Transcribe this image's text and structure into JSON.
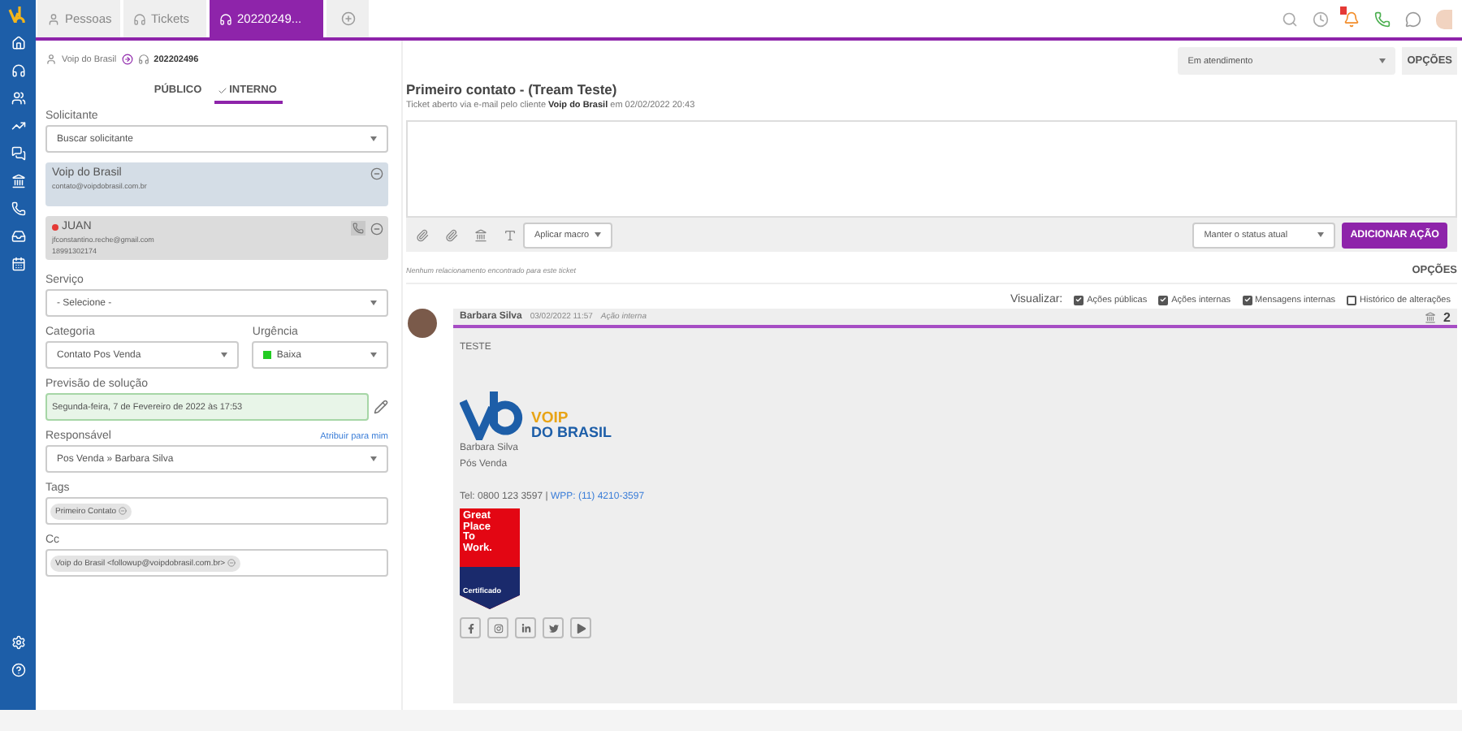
{
  "top_tabs": [
    {
      "label": "Pessoas",
      "selected": false
    },
    {
      "label": "Tickets",
      "selected": false
    },
    {
      "label": "20220249...",
      "selected": true
    }
  ],
  "breadcrumb": {
    "client": "Voip do Brasil",
    "ticket": "202202496"
  },
  "visibility_tabs": [
    {
      "label": "PÚBLICO",
      "selected": false
    },
    {
      "label": "INTERNO",
      "selected": true
    }
  ],
  "requester": {
    "label": "Solicitante",
    "placeholder": "Buscar solicitante"
  },
  "contacts": [
    {
      "kind": "company",
      "name": "Voip do Brasil",
      "lines": [
        "contato@voipdobrasil.com.br"
      ],
      "phone": false
    },
    {
      "kind": "person",
      "name": "JUAN",
      "lines": [
        "jfconstantino.reche@gmail.com",
        "18991302174"
      ],
      "color": "#e53935",
      "phone": true
    }
  ],
  "service": {
    "label": "Serviço",
    "value": "- Selecione -"
  },
  "category": {
    "label": "Categoria",
    "value": "Contato Pos Venda"
  },
  "urgency": {
    "label": "Urgência",
    "value": "Baixa",
    "color": "#22cc22"
  },
  "forecast": {
    "label": "Previsão de solução",
    "value": "Segunda-feira, 7 de Fevereiro de 2022 às 17:53"
  },
  "responsible": {
    "label": "Responsável",
    "link": "Atribuir para mim",
    "value": "Pos Venda » Barbara Silva"
  },
  "tags": {
    "label": "Tags",
    "items": [
      "Primeiro Contato"
    ]
  },
  "cc": {
    "label": "Cc",
    "items": [
      "Voip do Brasil <followup@voipdobrasil.com.br>"
    ]
  },
  "status": "Em atendimento",
  "options": "OPÇÕES",
  "ticket": {
    "title": "Primeiro contato - (Tream Teste)",
    "subtitle": "Ticket aberto via e-mail pelo cliente **Voip do Brasil** em 02/02/2022 20:43"
  },
  "editor": {
    "macro": "Aplicar macro",
    "keep_status": "Manter o status atual",
    "submit": "ADICIONAR AÇÃO"
  },
  "relations_note": "Nenhum relacionamento encontrado para este ticket",
  "relations_options": "OPÇÕES",
  "view": {
    "label": "Visualizar:",
    "filters": [
      {
        "label": "Ações públicas",
        "checked": true
      },
      {
        "label": "Ações internas",
        "checked": true
      },
      {
        "label": "Mensagens internas",
        "checked": true
      },
      {
        "label": "Histórico de alterações",
        "checked": false
      }
    ]
  },
  "message": {
    "author": "Barbara Silva",
    "date": "03/02/2022 11:57",
    "type": "Ação interna",
    "count": "2",
    "body": "TESTE",
    "signature": {
      "brand_top": "VOIP",
      "brand_bottom": "DO BRASIL",
      "name": "Barbara Silva",
      "role": "Pós Venda",
      "tel": "Tel: 0800 123 3597 |",
      "wpp": "WPP: (11) 4210-3597",
      "badge": [
        "Great",
        "Place",
        "To",
        "Work."
      ],
      "badge_cert": "Certificado"
    }
  }
}
